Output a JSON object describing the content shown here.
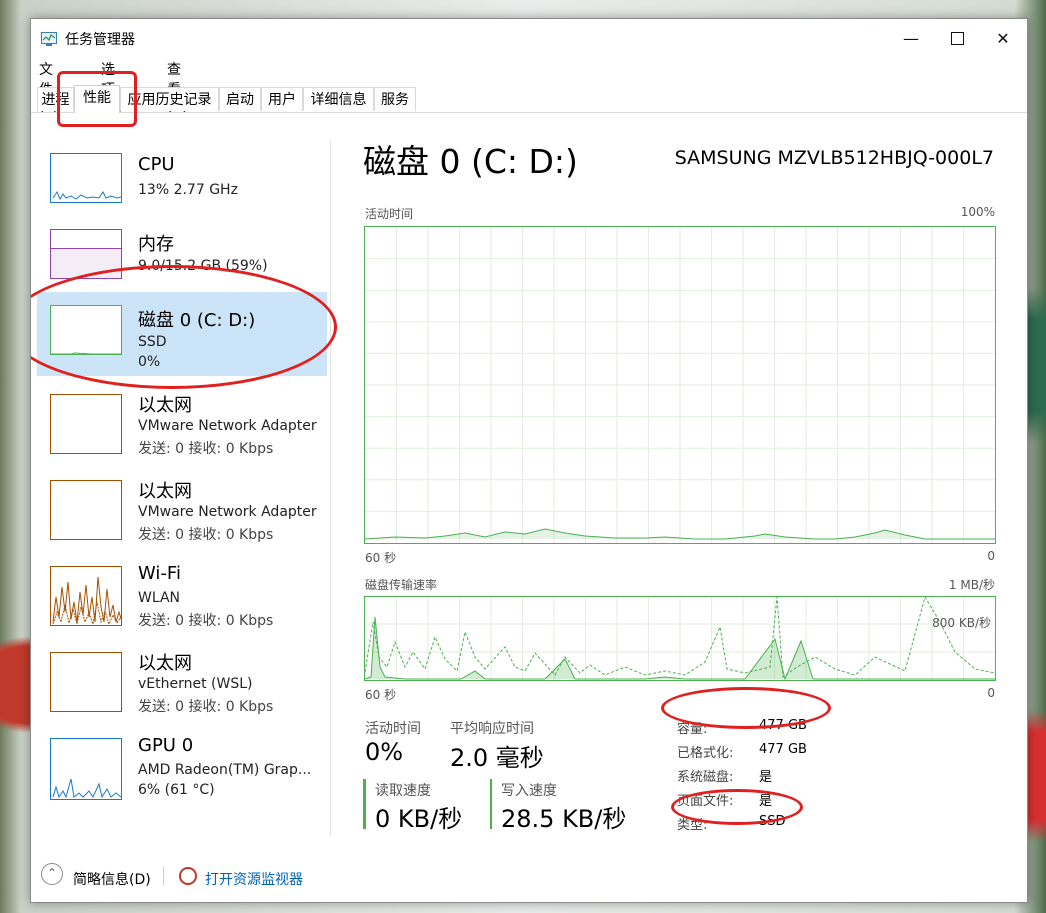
{
  "window": {
    "title": "任务管理器"
  },
  "menu": [
    {
      "label": "文件(F)"
    },
    {
      "label": "选项(O)"
    },
    {
      "label": "查看(V)"
    }
  ],
  "tabs": [
    {
      "label": "进程"
    },
    {
      "label": "性能"
    },
    {
      "label": "应用历史记录"
    },
    {
      "label": "启动"
    },
    {
      "label": "用户"
    },
    {
      "label": "详细信息"
    },
    {
      "label": "服务"
    }
  ],
  "active_tab": "性能",
  "sidebar": {
    "items": [
      {
        "name": "CPU",
        "line1": "13% 2.77 GHz",
        "line2": ""
      },
      {
        "name": "内存",
        "line1": "9.0/15.2 GB (59%)",
        "line2": ""
      },
      {
        "name": "磁盘 0 (C: D:)",
        "line1": "SSD",
        "line2": "0%"
      },
      {
        "name": "以太网",
        "line1": "VMware Network Adapter",
        "line2": "发送: 0 接收: 0 Kbps"
      },
      {
        "name": "以太网",
        "line1": "VMware Network Adapter",
        "line2": "发送: 0 接收: 0 Kbps"
      },
      {
        "name": "Wi-Fi",
        "line1": "WLAN",
        "line2": "发送: 0 接收: 0 Kbps"
      },
      {
        "name": "以太网",
        "line1": "vEthernet (WSL)",
        "line2": "发送: 0 接收: 0 Kbps"
      },
      {
        "name": "GPU 0",
        "line1": "AMD Radeon(TM) Grap...",
        "line2": "6% (61 °C)"
      }
    ]
  },
  "main": {
    "title": "磁盘 0 (C: D:)",
    "model": "SAMSUNG MZVLB512HBJQ-000L7",
    "graph1": {
      "label": "活动时间",
      "max": "100%",
      "left": "60 秒",
      "right": "0"
    },
    "graph2": {
      "label": "磁盘传输速率",
      "max": "1 MB/秒",
      "marker": "800 KB/秒",
      "left": "60 秒",
      "right": "0"
    },
    "stats": {
      "active_label": "活动时间",
      "active_value": "0%",
      "resp_label": "平均响应时间",
      "resp_value": "2.0 毫秒",
      "read_label": "读取速度",
      "read_value": "0 KB/秒",
      "write_label": "写入速度",
      "write_value": "28.5 KB/秒"
    },
    "info": [
      {
        "label": "容量:",
        "value": "477 GB"
      },
      {
        "label": "已格式化:",
        "value": "477 GB"
      },
      {
        "label": "系统磁盘:",
        "value": "是"
      },
      {
        "label": "页面文件:",
        "value": "是"
      },
      {
        "label": "类型:",
        "value": "SSD"
      }
    ]
  },
  "footer": {
    "summary": "简略信息(D)",
    "monitor": "打开资源监视器"
  },
  "colors": {
    "disk_green": "#4caf50",
    "cpu_blue": "#1979ca",
    "mem_purple": "#8e44ad",
    "wifi_orange": "#a74f01",
    "annotation_red": "#e02020",
    "selected_bg": "#cce4f7"
  }
}
